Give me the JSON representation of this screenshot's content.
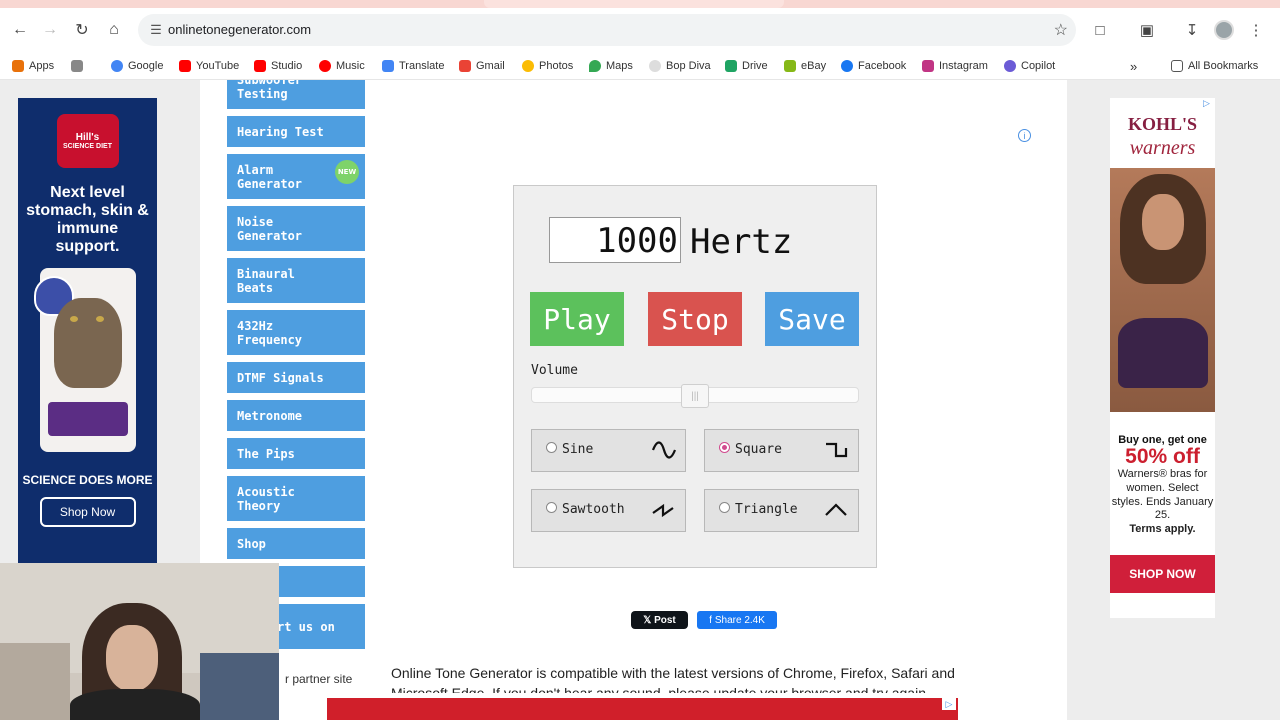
{
  "browser": {
    "url": "onlinetonegenerator.com",
    "bookmarks": [
      {
        "label": "Apps",
        "color": "#e8710a"
      },
      {
        "label": "",
        "color": "#666666"
      },
      {
        "label": "Google",
        "color": "#4285f4"
      },
      {
        "label": "YouTube",
        "color": "#ff0000"
      },
      {
        "label": "Studio",
        "color": "#ff0000"
      },
      {
        "label": "Music",
        "color": "#ff0000"
      },
      {
        "label": "Translate",
        "color": "#4285f4"
      },
      {
        "label": "Gmail",
        "color": "#ea4335"
      },
      {
        "label": "Photos",
        "color": "#fbbc04"
      },
      {
        "label": "Maps",
        "color": "#34a853"
      },
      {
        "label": "Bop Diva",
        "color": "#dddddd"
      },
      {
        "label": "Drive",
        "color": "#1fa463"
      },
      {
        "label": "eBay",
        "color": "#86b817"
      },
      {
        "label": "Facebook",
        "color": "#1877f2"
      },
      {
        "label": "Instagram",
        "color": "#c13584"
      },
      {
        "label": "Copilot",
        "color": "#6b5bd6"
      }
    ],
    "all_bookmarks_label": "All Bookmarks"
  },
  "sidebar": {
    "items": [
      {
        "label": "Subwoofer\nTesting"
      },
      {
        "label": "Hearing Test"
      },
      {
        "label": "Alarm\nGenerator",
        "badge": "NEW"
      },
      {
        "label": "Noise\nGenerator"
      },
      {
        "label": "Binaural\nBeats"
      },
      {
        "label": "432Hz\nFrequency"
      },
      {
        "label": "DTMF Signals"
      },
      {
        "label": "Metronome"
      },
      {
        "label": "The Pips"
      },
      {
        "label": "Acoustic\nTheory"
      },
      {
        "label": "Shop"
      },
      {
        "label": ""
      },
      {
        "label": "rt us on"
      }
    ],
    "partner_text": "r partner site"
  },
  "tone": {
    "frequency": "1000",
    "unit": "Hertz",
    "play_label": "Play",
    "stop_label": "Stop",
    "save_label": "Save",
    "play_color": "#5cc15c",
    "stop_color": "#d9534f",
    "save_color": "#4e9ee0",
    "volume_label": "Volume",
    "volume_fraction": 0.5,
    "waveforms": [
      {
        "label": "Sine",
        "checked": false,
        "icon": "sine-wave-icon"
      },
      {
        "label": "Square",
        "checked": true,
        "icon": "square-wave-icon"
      },
      {
        "label": "Sawtooth",
        "checked": false,
        "icon": "sawtooth-wave-icon"
      },
      {
        "label": "Triangle",
        "checked": false,
        "icon": "triangle-wave-icon"
      }
    ]
  },
  "social": {
    "x_post_label": "Post",
    "fb_share_label": "Share 2.4K"
  },
  "compat_text": "Online Tone Generator is compatible with the latest versions of Chrome, Firefox, Safari and",
  "compat_text_2": "Microsoft Edge. If you don't hear any sound, please update your browser and try again.",
  "ad_left": {
    "brand": "Hill's",
    "brand_sub": "SCIENCE DIET",
    "headline": "Next level stomach, skin & immune support.",
    "tagline": "SCIENCE DOES MORE",
    "cta": "Shop Now"
  },
  "ad_right": {
    "brand": "KOHL'S",
    "sub_brand": "warners",
    "promo": "Buy one, get one",
    "offer": "50% off",
    "detail": "Warners® bras for women. Select styles. Ends January 25.",
    "terms": "Terms apply.",
    "cta": "SHOP NOW"
  }
}
